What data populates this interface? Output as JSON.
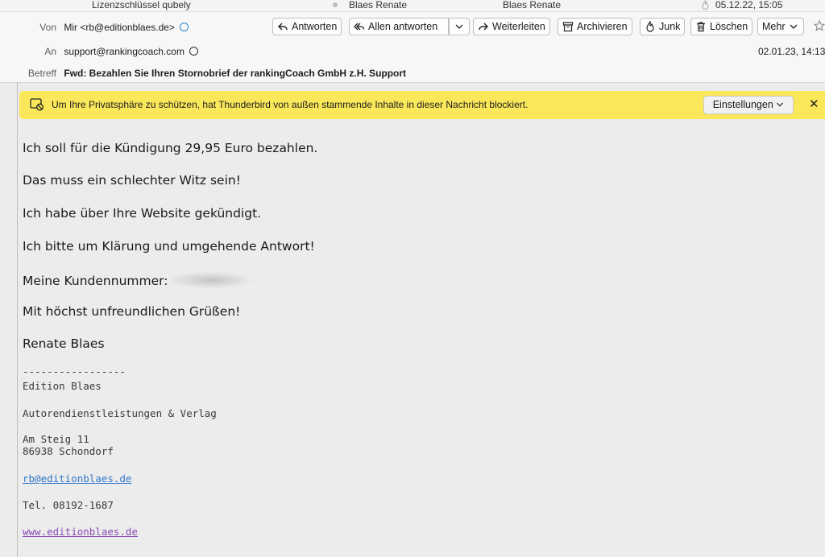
{
  "list_row": {
    "subject": "Lizenzschlüssel qubely",
    "correspondent": "Blaes Renate",
    "recipient": "Blaes Renate",
    "date": "05.12.22, 15:05"
  },
  "header": {
    "from_label": "Von",
    "from_value": "Mir <rb@editionblaes.de>",
    "to_label": "An",
    "to_value": "support@rankingcoach.com",
    "date": "02.01.23, 14:13",
    "subject_label": "Betreff",
    "subject_value": "Fwd: Bezahlen Sie Ihren Stornobrief der rankingCoach GmbH z.H. Support"
  },
  "toolbar": {
    "reply": "Antworten",
    "reply_all": "Allen antworten",
    "forward": "Weiterleiten",
    "archive": "Archivieren",
    "junk": "Junk",
    "delete": "Löschen",
    "more": "Mehr"
  },
  "notification": {
    "text": "Um Ihre Privatsphäre zu schützen, hat Thunderbird von außen stammende Inhalte in dieser Nachricht blockiert.",
    "settings_label": "Einstellungen",
    "close": "✕"
  },
  "body": {
    "lines": [
      "Ich soll für die Kündigung 29,95 Euro bezahlen.",
      "Das muss ein schlechter Witz sein!",
      "Ich habe über Ihre Website gekündigt.",
      "Ich bitte um Klärung und umgehende Antwort!",
      "Meine Kundennummer:",
      "Mit höchst unfreundlichen Grüßen!",
      "Renate Blaes"
    ]
  },
  "signature": {
    "separator": "-----------------",
    "company": "Edition Blaes",
    "tagline": "Autorendienstleistungen & Verlag",
    "street": "Am Steig 11",
    "city": "86938 Schondorf",
    "email": "rb@editionblaes.de",
    "phone": "Tel. 08192-1687",
    "website": "www.editionblaes.de"
  },
  "icons": {
    "reply": "reply-arrow-icon",
    "reply_all": "reply-all-icon",
    "forward": "forward-arrow-icon",
    "archive": "archive-box-icon",
    "junk": "flame-icon",
    "delete": "trash-icon",
    "star": "star-icon",
    "privacy": "shield-blocked-icon"
  },
  "colors": {
    "notification_bg": "#fbe85a",
    "link": "#2f76c9",
    "visited_link": "#8e4bb8",
    "contact_icon": "#2b85d8"
  }
}
